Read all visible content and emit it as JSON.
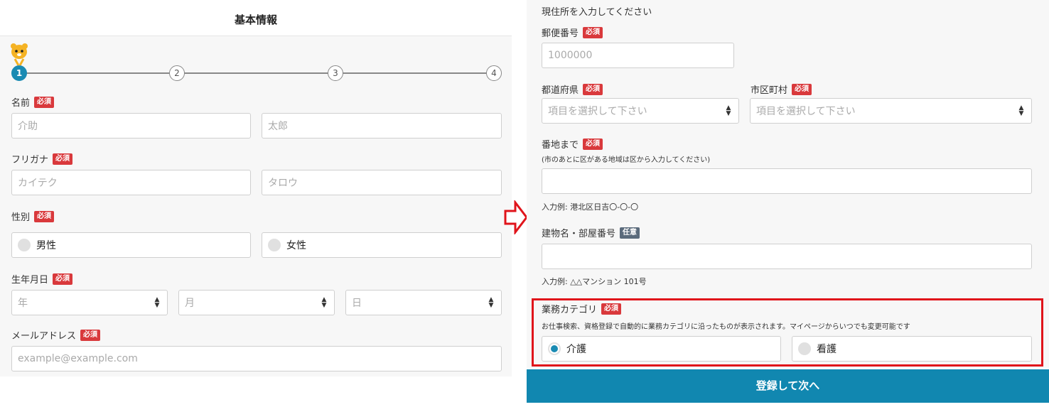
{
  "header": {
    "title": "基本情報"
  },
  "steps": [
    "1",
    "2",
    "3",
    "4"
  ],
  "required_badge": "必須",
  "optional_badge": "任意",
  "name": {
    "label": "名前",
    "last_placeholder": "介助",
    "first_placeholder": "太郎"
  },
  "kana": {
    "label": "フリガナ",
    "last_placeholder": "カイテク",
    "first_placeholder": "タロウ"
  },
  "gender": {
    "label": "性別",
    "options": [
      "男性",
      "女性"
    ]
  },
  "birthday": {
    "label": "生年月日",
    "year": "年",
    "month": "月",
    "day": "日"
  },
  "email": {
    "label": "メールアドレス",
    "placeholder": "example@example.com"
  },
  "address": {
    "heading": "現住所を入力してください",
    "postal_label": "郵便番号",
    "postal_placeholder": "1000000",
    "prefecture_label": "都道府県",
    "prefecture_value": "項目を選択して下さい",
    "city_label": "市区町村",
    "city_value": "項目を選択して下さい",
    "street_label": "番地まで",
    "street_note": "(市のあとに区がある地域は区から入力してください)",
    "street_example": "入力例: 港北区日吉〇-〇-〇",
    "building_label": "建物名・部屋番号",
    "building_example": "入力例: △△マンション 101号"
  },
  "category": {
    "label": "業務カテゴリ",
    "note": "お仕事検索、資格登録で自動的に業務カテゴリに沿ったものが表示されます。マイページからいつでも変更可能です",
    "options": [
      "介護",
      "看護"
    ],
    "selected": "介護"
  },
  "submit_label": "登録して次へ",
  "colors": {
    "accent": "#1187b0",
    "required": "#d9393c",
    "highlight": "#e0141b"
  }
}
